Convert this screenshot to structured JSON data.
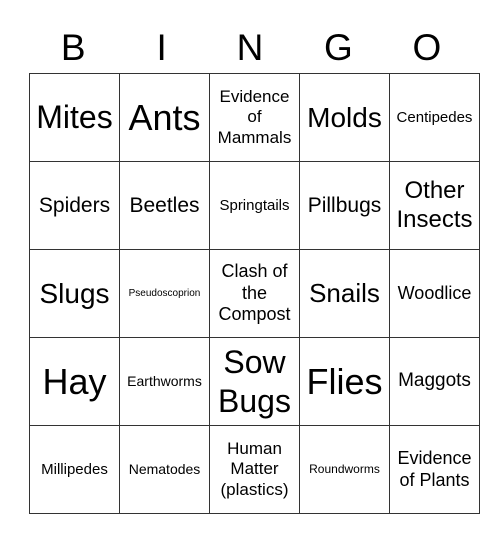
{
  "header": [
    "B",
    "I",
    "N",
    "G",
    "O"
  ],
  "rows": [
    [
      "Mites",
      "Ants",
      "Evidence of Mammals",
      "Molds",
      "Centipedes"
    ],
    [
      "Spiders",
      "Beetles",
      "Springtails",
      "Pillbugs",
      "Other Insects"
    ],
    [
      "Slugs",
      "Pseudoscoprion",
      "Clash of the Compost",
      "Snails",
      "Woodlice"
    ],
    [
      "Hay",
      "Earthworms",
      "Sow Bugs",
      "Flies",
      "Maggots"
    ],
    [
      "Millipedes",
      "Nematodes",
      "Human Matter (plastics)",
      "Roundworms",
      "Evidence of Plants"
    ]
  ]
}
